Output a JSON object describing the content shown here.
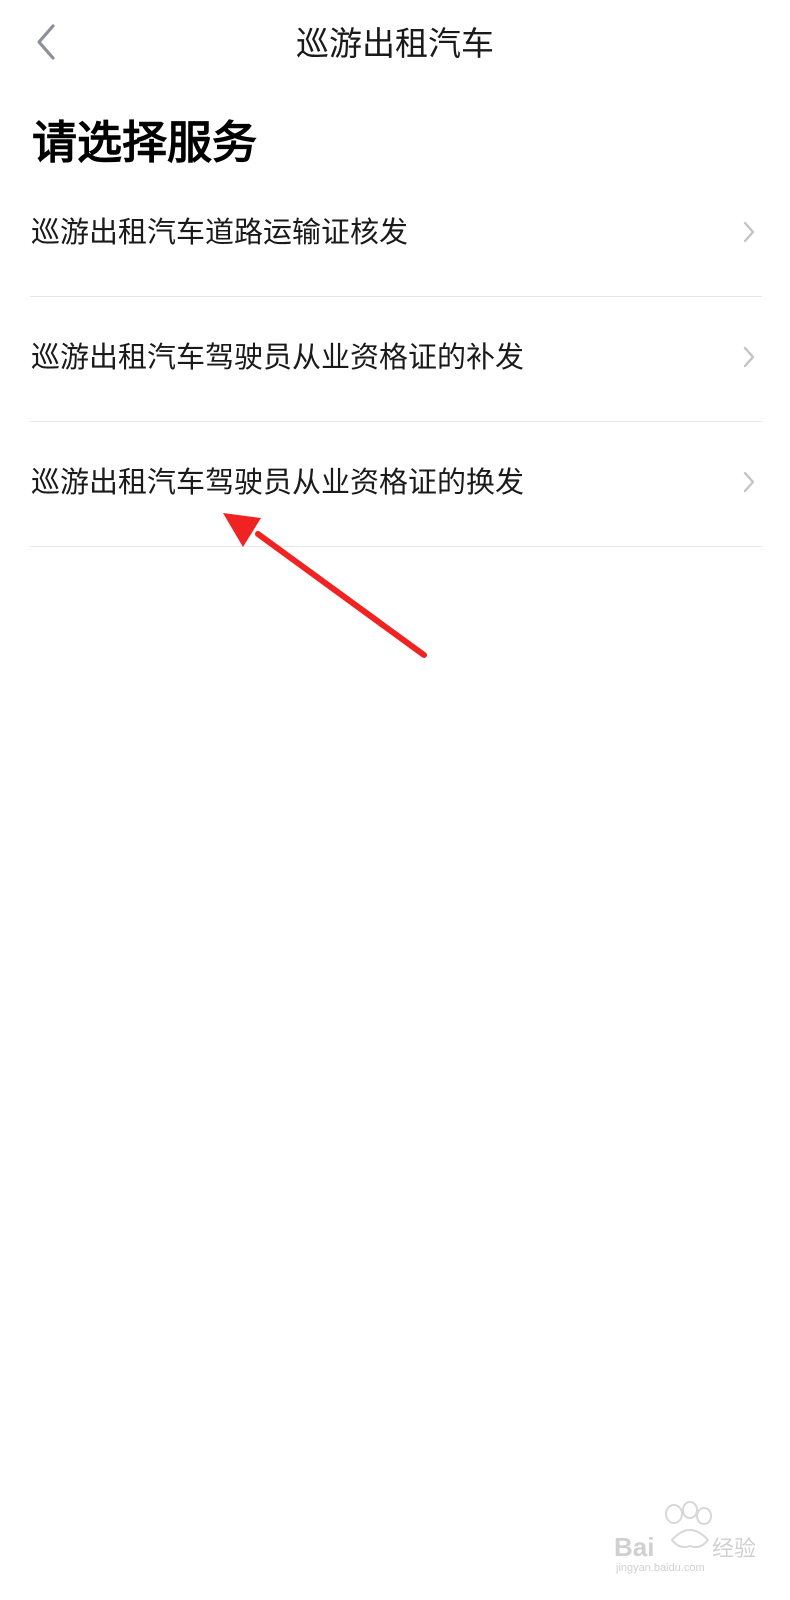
{
  "nav": {
    "title": "巡游出租汽车",
    "back_icon": "chevron-left-icon"
  },
  "section": {
    "title": "请选择服务"
  },
  "services": [
    {
      "label": "巡游出租汽车道路运输证核发",
      "icon": "chevron-right-icon"
    },
    {
      "label": "巡游出租汽车驾驶员从业资格证的补发",
      "icon": "chevron-right-icon"
    },
    {
      "label": "巡游出租汽车驾驶员从业资格证的换发",
      "icon": "chevron-right-icon"
    }
  ],
  "annotation": {
    "type": "arrow",
    "color": "#f02222",
    "points_to": "services.2"
  },
  "watermark": {
    "brand": "Baidu经验",
    "domain": "jingyan.baidu.com"
  },
  "colors": {
    "background": "#ffffff",
    "text": "#1a1a1a",
    "divider": "#e6e6e6",
    "chevron": "#c4c4c4",
    "back_icon": "#8a8f99"
  }
}
